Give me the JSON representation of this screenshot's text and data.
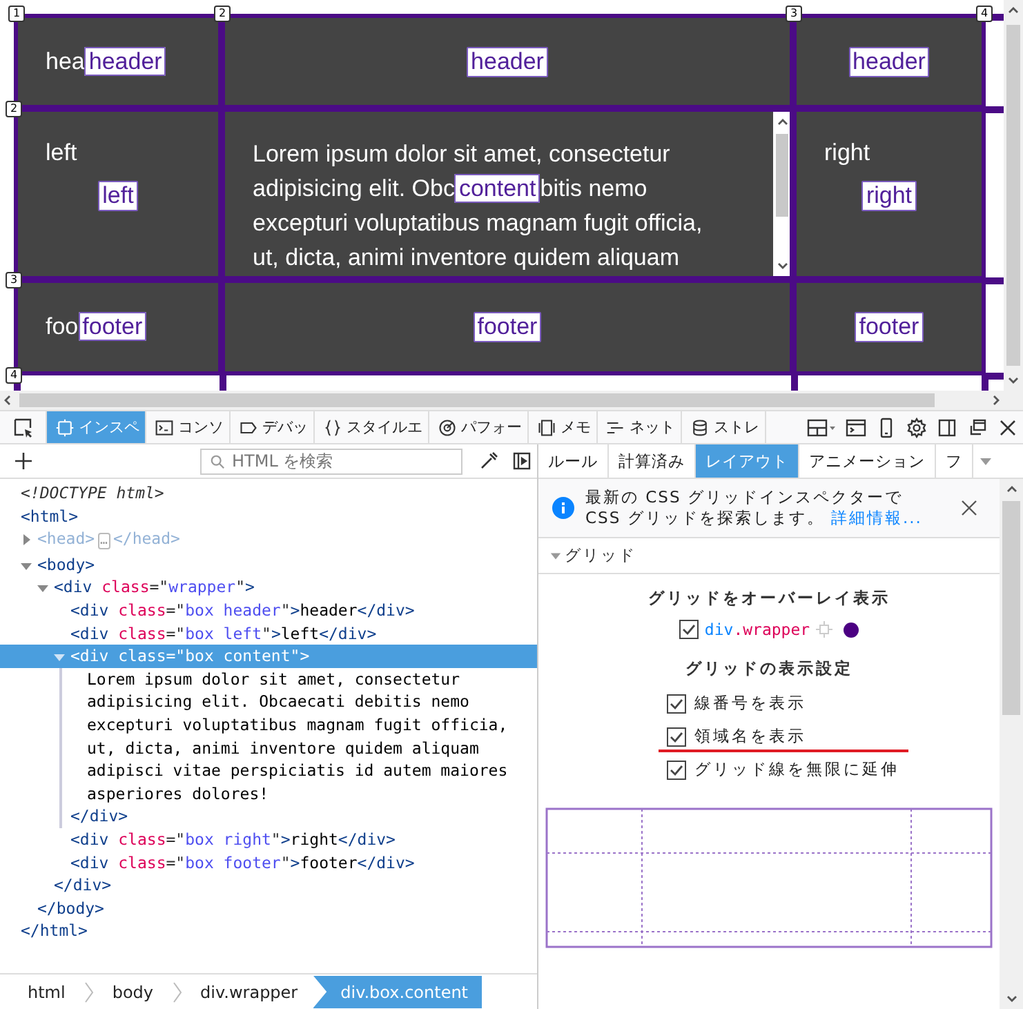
{
  "preview": {
    "column_numbers": [
      "1",
      "2",
      "3",
      "4"
    ],
    "row_numbers": [
      "2",
      "3",
      "4"
    ],
    "cells": [
      {
        "kind": "inline",
        "text": "hea",
        "label": "header"
      },
      {
        "kind": "centered",
        "label": "header"
      },
      {
        "kind": "centered",
        "label": "header"
      },
      {
        "kind": "stacked",
        "text": "left",
        "label": "left"
      },
      {
        "kind": "scroll",
        "lines": [
          [
            {
              "text": "Lorem ipsum dolor sit amet, consectetur"
            }
          ],
          [
            {
              "text": "adipisicing elit. Obc"
            },
            {
              "label": "content"
            },
            {
              "text": "bitis nemo"
            }
          ],
          [
            {
              "text": "excepturi voluptatibus magnam fugit officia,"
            }
          ],
          [
            {
              "text": "ut, dicta, animi inventore quidem aliquam"
            }
          ]
        ]
      },
      {
        "kind": "stacked",
        "text": "right",
        "label": "right"
      },
      {
        "kind": "inline",
        "text": "foo",
        "label": "footer"
      },
      {
        "kind": "centered",
        "label": "footer"
      },
      {
        "kind": "centered",
        "label": "footer"
      }
    ]
  },
  "toolbar": {
    "tabs": [
      {
        "label": "インスペ",
        "selected": true
      },
      {
        "label": "コンソ",
        "selected": false
      },
      {
        "label": "デバッ",
        "selected": false
      },
      {
        "label": "スタイルエ",
        "selected": false
      },
      {
        "label": "パフォー",
        "selected": false
      },
      {
        "label": "メモ",
        "selected": false
      },
      {
        "label": "ネット",
        "selected": false
      },
      {
        "label": "ストレ",
        "selected": false
      }
    ]
  },
  "inspector": {
    "search": {
      "placeholder": "HTML を検索"
    },
    "tree": [
      {
        "selected": false,
        "parts": [
          {
            "kind": "doctype",
            "text": "<!DOCTYPE html>"
          }
        ]
      },
      {
        "selected": false,
        "parts": [
          {
            "kind": "tag",
            "text": "<html>"
          }
        ],
        "close": [
          {
            "kind": "tag",
            "text": "</html>"
          }
        ],
        "children": [
          {
            "selected": false,
            "expanded": false,
            "parts": [
              {
                "kind": "dim",
                "text": "<head>"
              },
              {
                "kind": "more",
                "text": "…"
              },
              {
                "kind": "dim",
                "text": "</head>"
              }
            ]
          },
          {
            "selected": false,
            "expanded": true,
            "parts": [
              {
                "kind": "tag",
                "text": "<body>"
              }
            ],
            "close": [
              {
                "kind": "tag",
                "text": "</body>"
              }
            ],
            "children": [
              {
                "selected": false,
                "expanded": true,
                "parts": [
                  {
                    "kind": "tag",
                    "text": "<div "
                  },
                  {
                    "kind": "attr",
                    "text": "class"
                  },
                  {
                    "kind": "punct",
                    "text": "=\""
                  },
                  {
                    "kind": "value",
                    "text": "wrapper"
                  },
                  {
                    "kind": "punct",
                    "text": "\""
                  },
                  {
                    "kind": "tag",
                    "text": ">"
                  }
                ],
                "close": [
                  {
                    "kind": "tag",
                    "text": "</div>"
                  }
                ],
                "children": [
                  {
                    "selected": false,
                    "parts": [
                      {
                        "kind": "tag",
                        "text": "<div "
                      },
                      {
                        "kind": "attr",
                        "text": "class"
                      },
                      {
                        "kind": "punct",
                        "text": "=\""
                      },
                      {
                        "kind": "value",
                        "text": "box header"
                      },
                      {
                        "kind": "punct",
                        "text": "\""
                      },
                      {
                        "kind": "tag",
                        "text": ">"
                      },
                      {
                        "kind": "text",
                        "text": "header"
                      },
                      {
                        "kind": "tag",
                        "text": "</div>"
                      }
                    ]
                  },
                  {
                    "selected": false,
                    "parts": [
                      {
                        "kind": "tag",
                        "text": "<div "
                      },
                      {
                        "kind": "attr",
                        "text": "class"
                      },
                      {
                        "kind": "punct",
                        "text": "=\""
                      },
                      {
                        "kind": "value",
                        "text": "box left"
                      },
                      {
                        "kind": "punct",
                        "text": "\""
                      },
                      {
                        "kind": "tag",
                        "text": ">"
                      },
                      {
                        "kind": "text",
                        "text": "left"
                      },
                      {
                        "kind": "tag",
                        "text": "</div>"
                      }
                    ]
                  },
                  {
                    "selected": true,
                    "expanded": true,
                    "parts": [
                      {
                        "kind": "tag",
                        "text": "<div "
                      },
                      {
                        "kind": "attr",
                        "text": "class"
                      },
                      {
                        "kind": "punct",
                        "text": "=\""
                      },
                      {
                        "kind": "value",
                        "text": "box content"
                      },
                      {
                        "kind": "punct",
                        "text": "\""
                      },
                      {
                        "kind": "tag",
                        "text": ">"
                      }
                    ],
                    "close": [
                      {
                        "kind": "tag",
                        "text": "</div>"
                      }
                    ],
                    "children": [
                      {
                        "selected": false,
                        "parts": [
                          {
                            "kind": "text",
                            "text": "Lorem ipsum dolor sit amet, consectetur adipisicing elit. Obcaecati debitis nemo excepturi voluptatibus magnam fugit officia, ut, dicta, animi inventore quidem aliquam adipisci vitae perspiciatis id autem maiores asperiores dolores!"
                          }
                        ]
                      }
                    ]
                  },
                  {
                    "selected": false,
                    "parts": [
                      {
                        "kind": "tag",
                        "text": "<div "
                      },
                      {
                        "kind": "attr",
                        "text": "class"
                      },
                      {
                        "kind": "punct",
                        "text": "=\""
                      },
                      {
                        "kind": "value",
                        "text": "box right"
                      },
                      {
                        "kind": "punct",
                        "text": "\""
                      },
                      {
                        "kind": "tag",
                        "text": ">"
                      },
                      {
                        "kind": "text",
                        "text": "right"
                      },
                      {
                        "kind": "tag",
                        "text": "</div>"
                      }
                    ]
                  },
                  {
                    "selected": false,
                    "parts": [
                      {
                        "kind": "tag",
                        "text": "<div "
                      },
                      {
                        "kind": "attr",
                        "text": "class"
                      },
                      {
                        "kind": "punct",
                        "text": "=\""
                      },
                      {
                        "kind": "value",
                        "text": "box footer"
                      },
                      {
                        "kind": "punct",
                        "text": "\""
                      },
                      {
                        "kind": "tag",
                        "text": ">"
                      },
                      {
                        "kind": "text",
                        "text": "footer"
                      },
                      {
                        "kind": "tag",
                        "text": "</div>"
                      }
                    ]
                  }
                ]
              }
            ]
          }
        ]
      }
    ],
    "breadcrumbs": [
      {
        "label": "html",
        "selected": false
      },
      {
        "label": "body",
        "selected": false
      },
      {
        "label": "div.wrapper",
        "selected": false
      },
      {
        "label": "div.box.content",
        "selected": true
      }
    ]
  },
  "sidebar": {
    "tabs": [
      {
        "label": "ルール",
        "selected": false
      },
      {
        "label": "計算済み",
        "selected": false
      },
      {
        "label": "レイアウト",
        "selected": true
      },
      {
        "label": "アニメーション",
        "selected": false
      },
      {
        "label": "フ",
        "selected": false
      }
    ],
    "notice": {
      "text": "最新の CSS グリッドインスペクターで CSS グリッドを探索します。",
      "link": "詳細情報..."
    },
    "section": {
      "title": "グリッド",
      "expanded": true,
      "overlay_heading": "グリッドをオーバーレイ表示",
      "grids": [
        {
          "element": "div",
          "class": ".wrapper",
          "checked": true,
          "color": "#4b0082"
        }
      ],
      "settings_heading": "グリッドの表示設定",
      "settings": [
        {
          "label": "線番号を表示",
          "checked": true,
          "highlighted": false
        },
        {
          "label": "領域名を表示",
          "checked": true,
          "highlighted": true
        },
        {
          "label": "グリッド線を無限に延伸",
          "checked": true,
          "highlighted": false
        }
      ]
    }
  }
}
